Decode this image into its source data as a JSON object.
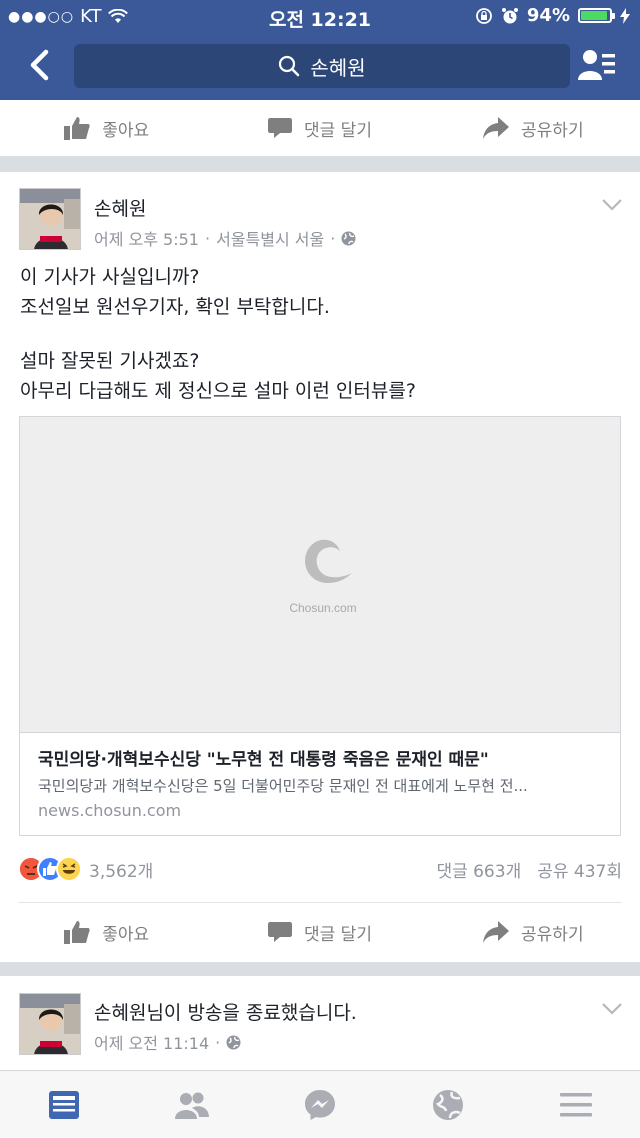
{
  "status_bar": {
    "carrier": "KT",
    "time": "오전 12:21",
    "battery": "94%"
  },
  "nav": {
    "search_text": "손혜원"
  },
  "actions": {
    "like": "좋아요",
    "comment": "댓글 달기",
    "share": "공유하기"
  },
  "post": {
    "author": "손혜원",
    "time": "어제 오후 5:51",
    "location": "서울특별시 서울",
    "lines": [
      "이 기사가 사실입니까?",
      "조선일보 원선우기자, 확인 부탁합니다.",
      "설마 잘못된 기사겠죠?",
      "아무리 다급해도 제 정신으로 설마 이런 인터뷰를?"
    ],
    "link": {
      "image_logo_text": "Chosun.com",
      "title": "국민의당·개혁보수신당 \"노무현 전 대통령 죽음은 문재인 때문\"",
      "description": "국민의당과 개혁보수신당은 5일 더불어민주당 문재인 전 대표에게 노무현 전...",
      "source": "news.chosun.com"
    },
    "reaction_count": "3,562개",
    "comments": "댓글 663개",
    "shares": "공유 437회"
  },
  "next_post": {
    "text": "손혜원님이 방송을 종료했습니다.",
    "time": "어제 오전 11:14"
  },
  "colors": {
    "brand": "#3b5998",
    "icon_gray": "#7f7f7f",
    "meta_gray": "#90949c"
  },
  "tabs": [
    "news-feed",
    "friends",
    "messenger",
    "notifications",
    "more"
  ]
}
